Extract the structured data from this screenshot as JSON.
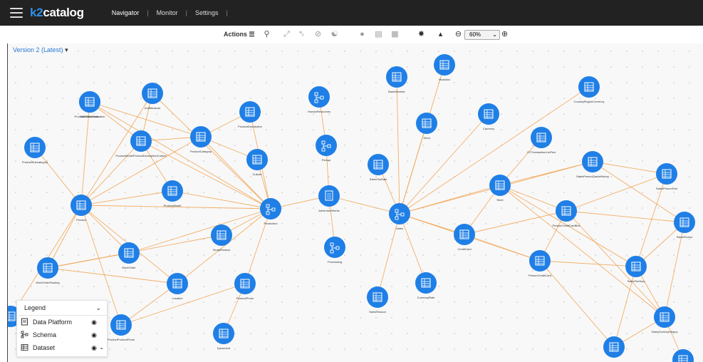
{
  "app": {
    "logo_k2": "k2",
    "logo_text": "catalog"
  },
  "nav": [
    {
      "label": "Navigator",
      "active": true
    },
    {
      "label": "Monitor",
      "active": false
    },
    {
      "label": "Settings",
      "active": false
    }
  ],
  "toolbar": {
    "actions_label": "Actions ☰",
    "zoom": "60%"
  },
  "version": {
    "label": "Version 2 (Latest)"
  },
  "legend": {
    "title": "Legend",
    "items": [
      {
        "label": "Data Platform",
        "icon": "data-platform-icon"
      },
      {
        "label": "Schema",
        "icon": "schema-icon"
      },
      {
        "label": "Dataset",
        "icon": "dataset-icon"
      }
    ]
  },
  "colors": {
    "node": "#1f7fe6",
    "edge": "#f2a24e",
    "topbar": "#222222",
    "link": "#2a7bd4"
  },
  "nodes": [
    {
      "id": "BillOfMaterials",
      "label": "BillOfMaterials",
      "kind": "dataset"
    },
    {
      "id": "ProductModelIllustration",
      "label": "ProductModelIllustration",
      "kind": "dataset"
    },
    {
      "id": "UnitMeasure",
      "label": "UnitMeasure",
      "kind": "dataset"
    },
    {
      "id": "ProductDescription",
      "label": "ProductDescription",
      "kind": "dataset"
    },
    {
      "id": "HumanResources",
      "label": "HumanResources",
      "kind": "schema"
    },
    {
      "id": "BankMember",
      "label": "BankMember",
      "kind": "dataset"
    },
    {
      "id": "Musician",
      "label": "Musician",
      "kind": "dataset"
    },
    {
      "id": "CountryRegionCurrency",
      "label": "CountryRegionCurrency",
      "kind": "dataset"
    },
    {
      "id": "ProductSubcategory",
      "label": "ProductSubcategory",
      "kind": "dataset"
    },
    {
      "id": "ProductModelProductDescriptionCulture",
      "label": "ProductModelProductDescriptionCulture",
      "kind": "dataset"
    },
    {
      "id": "ProductCategory",
      "label": "ProductCategory",
      "kind": "dataset"
    },
    {
      "id": "Culture",
      "label": "Culture",
      "kind": "dataset"
    },
    {
      "id": "Person",
      "label": "Person",
      "kind": "schema"
    },
    {
      "id": "Send",
      "label": "Send",
      "kind": "dataset"
    },
    {
      "id": "Currency",
      "label": "Currency",
      "kind": "dataset"
    },
    {
      "id": "CCTransactionListText",
      "label": "CCTransactionListText",
      "kind": "dataset"
    },
    {
      "id": "SalesTaxRate",
      "label": "SalesTaxRate",
      "kind": "dataset"
    },
    {
      "id": "SalesPersonQuotaHistory",
      "label": "SalesPersonQuotaHistory",
      "kind": "dataset"
    },
    {
      "id": "SalesPersonText",
      "label": "SalesPersonText",
      "kind": "dataset"
    },
    {
      "id": "ProductModel",
      "label": "ProductModel",
      "kind": "dataset"
    },
    {
      "id": "AdventureWorks",
      "label": "AdventureWorks",
      "kind": "platform"
    },
    {
      "id": "Store",
      "label": "Store",
      "kind": "dataset"
    },
    {
      "id": "Product",
      "label": "Product",
      "kind": "dataset"
    },
    {
      "id": "Production",
      "label": "Production",
      "kind": "schema"
    },
    {
      "id": "Sales",
      "label": "Sales",
      "kind": "schema"
    },
    {
      "id": "PersonCreditCardBox",
      "label": "PersonCreditCardBox",
      "kind": "dataset"
    },
    {
      "id": "SalesPerson",
      "label": "SalesPerson",
      "kind": "dataset"
    },
    {
      "id": "ScrapReason",
      "label": "ScrapReason",
      "kind": "dataset"
    },
    {
      "id": "CreditCard",
      "label": "CreditCard",
      "kind": "dataset"
    },
    {
      "id": "Purchasing",
      "label": "Purchasing",
      "kind": "schema"
    },
    {
      "id": "WorkOrder",
      "label": "WorkOrder",
      "kind": "dataset"
    },
    {
      "id": "PersonCreditCard",
      "label": "PersonCreditCard",
      "kind": "dataset"
    },
    {
      "id": "WorkOrderRouting",
      "label": "WorkOrderRouting",
      "kind": "dataset"
    },
    {
      "id": "SalesTerritory",
      "label": "SalesTerritory",
      "kind": "dataset"
    },
    {
      "id": "Location",
      "label": "Location",
      "kind": "dataset"
    },
    {
      "id": "ProductPhoto",
      "label": "ProductPhoto",
      "kind": "dataset"
    },
    {
      "id": "CurrencyRate",
      "label": "CurrencyRate",
      "kind": "dataset"
    },
    {
      "id": "SalesReason",
      "label": "SalesReason",
      "kind": "dataset"
    },
    {
      "id": "SalesTerritoryHistory",
      "label": "SalesTerritoryHistory",
      "kind": "dataset"
    },
    {
      "id": "ProductProductPhoto",
      "label": "ProductProductPhoto",
      "kind": "dataset"
    },
    {
      "id": "Document",
      "label": "Document",
      "kind": "dataset"
    },
    {
      "id": "EdgeLeft",
      "label": "",
      "kind": "dataset"
    },
    {
      "id": "BottomRight1",
      "label": "",
      "kind": "dataset"
    },
    {
      "id": "BottomRight2",
      "label": "",
      "kind": "dataset"
    }
  ],
  "edges": [
    [
      "Production",
      "Product"
    ],
    [
      "Production",
      "ProductModel"
    ],
    [
      "Production",
      "Culture"
    ],
    [
      "Production",
      "ProductDescription"
    ],
    [
      "Production",
      "ProductCategory"
    ],
    [
      "Production",
      "ProductModelProductDescriptionCulture"
    ],
    [
      "Production",
      "ScrapReason"
    ],
    [
      "Production",
      "WorkOrder"
    ],
    [
      "Production",
      "ProductPhoto"
    ],
    [
      "Production",
      "Location"
    ],
    [
      "Production",
      "UnitMeasure"
    ],
    [
      "Production",
      "ProductModelIllustration"
    ],
    [
      "Production",
      "AdventureWorks"
    ],
    [
      "AdventureWorks",
      "Person"
    ],
    [
      "AdventureWorks",
      "Purchasing"
    ],
    [
      "AdventureWorks",
      "Sales"
    ],
    [
      "Person",
      "HumanResources"
    ],
    [
      "Product",
      "ProductSubcategory"
    ],
    [
      "Product",
      "ProductModelIllustration"
    ],
    [
      "Product",
      "ProductModelProductDescriptionCulture"
    ],
    [
      "Product",
      "ProductCategory"
    ],
    [
      "Product",
      "WorkOrderRouting"
    ],
    [
      "Product",
      "WorkOrder"
    ],
    [
      "Product",
      "UnitMeasure"
    ],
    [
      "Product",
      "ProductModel"
    ],
    [
      "Product",
      "Location"
    ],
    [
      "Product",
      "ProductProductPhoto"
    ],
    [
      "Product",
      "EdgeLeft"
    ],
    [
      "WorkOrderRouting",
      "WorkOrder"
    ],
    [
      "WorkOrderRouting",
      "Location"
    ],
    [
      "WorkOrderRouting",
      "ScrapReason"
    ],
    [
      "ProductModelIllustration",
      "ProductModelProductDescriptionCulture"
    ],
    [
      "ProductModelIllustration",
      "ProductCategory"
    ],
    [
      "ProductModelProductDescriptionCulture",
      "ProductCategory"
    ],
    [
      "ProductModelProductDescriptionCulture",
      "ProductModel"
    ],
    [
      "ProductCategory",
      "Culture"
    ],
    [
      "ProductCategory",
      "ProductDescription"
    ],
    [
      "UnitMeasure",
      "ProductModelProductDescriptionCulture"
    ],
    [
      "BillOfMaterials",
      "ProductModelIllustration"
    ],
    [
      "ProductPhoto",
      "ProductProductPhoto"
    ],
    [
      "ProductPhoto",
      "Document"
    ],
    [
      "Location",
      "ProductProductPhoto"
    ],
    [
      "Sales",
      "BankMember"
    ],
    [
      "Sales",
      "Musician"
    ],
    [
      "Sales",
      "Send"
    ],
    [
      "Sales",
      "Currency"
    ],
    [
      "Sales",
      "SalesTaxRate"
    ],
    [
      "Sales",
      "Store"
    ],
    [
      "Sales",
      "CreditCard"
    ],
    [
      "Sales",
      "SalesReason"
    ],
    [
      "Sales",
      "CurrencyRate"
    ],
    [
      "Sales",
      "CountryRegionCurrency"
    ],
    [
      "Sales",
      "PersonCreditCard"
    ],
    [
      "Sales",
      "SalesPersonQuotaHistory"
    ],
    [
      "Store",
      "CCTransactionListText"
    ],
    [
      "Store",
      "SalesPersonQuotaHistory"
    ],
    [
      "Store",
      "PersonCreditCardBox"
    ],
    [
      "Store",
      "SalesTerritory"
    ],
    [
      "Store",
      "CreditCard"
    ],
    [
      "Store",
      "SalesTerritoryHistory"
    ],
    [
      "PersonCreditCardBox",
      "SalesPerson"
    ],
    [
      "PersonCreditCardBox",
      "SalesPersonText"
    ],
    [
      "PersonCreditCardBox",
      "CreditCard"
    ],
    [
      "PersonCreditCardBox",
      "PersonCreditCard"
    ],
    [
      "PersonCreditCardBox",
      "SalesTerritoryHistory"
    ],
    [
      "SalesPersonQuotaHistory",
      "SalesPersonText"
    ],
    [
      "SalesPersonQuotaHistory",
      "SalesPerson"
    ],
    [
      "SalesPersonText",
      "SalesTerritory"
    ],
    [
      "SalesPerson",
      "SalesTerritory"
    ],
    [
      "SalesPerson",
      "SalesTerritoryHistory"
    ],
    [
      "SalesTerritory",
      "SalesTerritoryHistory"
    ],
    [
      "SalesTerritory",
      "BottomRight1"
    ],
    [
      "SalesTerritory",
      "PersonCreditCard"
    ],
    [
      "PersonCreditCard",
      "BottomRight1"
    ],
    [
      "PersonCreditCard",
      "CreditCard"
    ],
    [
      "SalesTerritoryHistory",
      "BottomRight2"
    ],
    [
      "SalesTerritoryHistory",
      "BottomRight1"
    ]
  ]
}
